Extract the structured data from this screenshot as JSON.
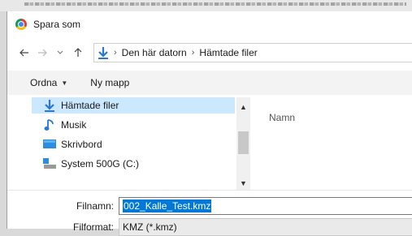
{
  "window": {
    "title": "Spara som"
  },
  "navigation": {
    "breadcrumb": [
      "Den här datorn",
      "Hämtade filer"
    ],
    "separator": "›"
  },
  "toolbar": {
    "organize_label": "Ordna",
    "new_folder_label": "Ny mapp"
  },
  "nav_pane": {
    "items": [
      {
        "label": "Hämtade filer",
        "icon": "download-arrow-icon",
        "selected": true
      },
      {
        "label": "Musik",
        "icon": "music-note-icon",
        "selected": false
      },
      {
        "label": "Skrivbord",
        "icon": "desktop-icon",
        "selected": false
      },
      {
        "label": "System 500G (C:)",
        "icon": "drive-icon",
        "selected": false
      }
    ]
  },
  "file_list": {
    "column_name": "Namn"
  },
  "form": {
    "filename_label": "Filnamn:",
    "filename_value": "002_Kalle_Test.kmz",
    "format_label": "Filformat:",
    "format_value": "KMZ (*.kmz)"
  },
  "colors": {
    "selection": "#cce8ff",
    "text_selection": "#0078d7",
    "accent_blue": "#2a78d6"
  }
}
